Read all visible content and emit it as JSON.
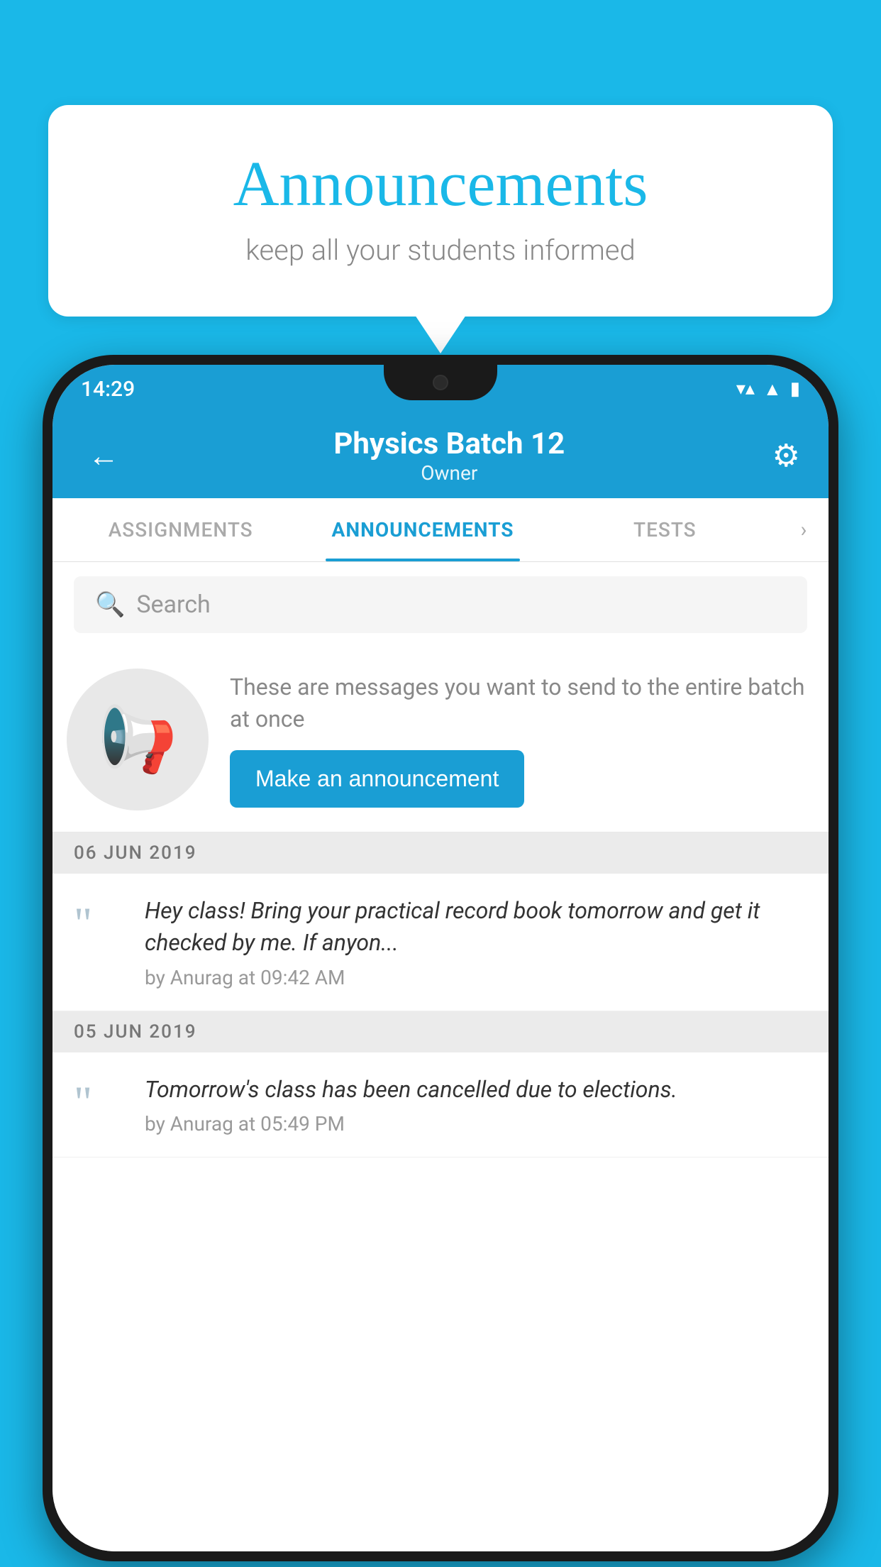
{
  "background_color": "#1ab8e8",
  "speech_bubble": {
    "title": "Announcements",
    "subtitle": "keep all your students informed"
  },
  "phone": {
    "status_bar": {
      "time": "14:29",
      "icons": [
        "wifi",
        "signal",
        "battery"
      ]
    },
    "app_bar": {
      "back_label": "←",
      "title": "Physics Batch 12",
      "subtitle": "Owner",
      "settings_label": "⚙"
    },
    "tabs": [
      {
        "label": "ASSIGNMENTS",
        "active": false
      },
      {
        "label": "ANNOUNCEMENTS",
        "active": true
      },
      {
        "label": "TESTS",
        "active": false
      }
    ],
    "search": {
      "placeholder": "Search"
    },
    "promo": {
      "description": "These are messages you want to send to the entire batch at once",
      "button_label": "Make an announcement"
    },
    "announcements": [
      {
        "date": "06  JUN  2019",
        "text": "Hey class! Bring your practical record book tomorrow and get it checked by me. If anyon...",
        "author": "by Anurag at 09:42 AM"
      },
      {
        "date": "05  JUN  2019",
        "text": "Tomorrow's class has been cancelled due to elections.",
        "author": "by Anurag at 05:49 PM"
      }
    ]
  }
}
